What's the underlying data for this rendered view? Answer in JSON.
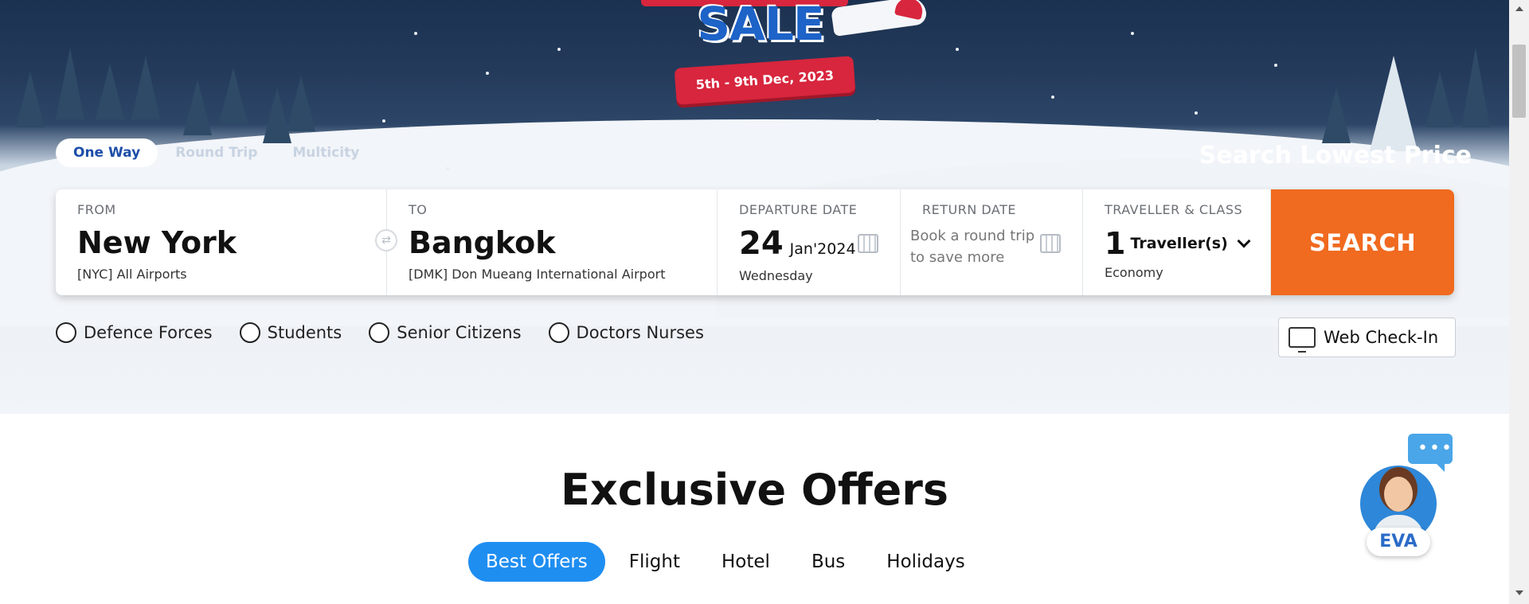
{
  "banner": {
    "headline": "SALE",
    "dates": "5th - 9th Dec, 2023"
  },
  "trip_types": [
    {
      "label": "One Way",
      "active": true
    },
    {
      "label": "Round Trip",
      "active": false
    },
    {
      "label": "Multicity",
      "active": false
    }
  ],
  "tagline": "Search Lowest Price",
  "search": {
    "from": {
      "label": "FROM",
      "city": "New York",
      "airport": "[NYC] All Airports"
    },
    "to": {
      "label": "TO",
      "city": "Bangkok",
      "airport": "[DMK] Don Mueang International Airport"
    },
    "departure": {
      "label": "DEPARTURE DATE",
      "day": "24",
      "month_year": "Jan'2024",
      "weekday": "Wednesday"
    },
    "return": {
      "label": "RETURN DATE",
      "note": "Book a round trip to save more"
    },
    "traveller": {
      "label": "TRAVELLER & CLASS",
      "count": "1",
      "unit": "Traveller(s)",
      "class": "Economy"
    },
    "button": "SEARCH"
  },
  "special_fares": [
    "Defence Forces",
    "Students",
    "Senior Citizens",
    "Doctors Nurses"
  ],
  "web_checkin": "Web Check-In",
  "offers": {
    "title": "Exclusive Offers",
    "tabs": [
      {
        "label": "Best Offers",
        "active": true
      },
      {
        "label": "Flight",
        "active": false
      },
      {
        "label": "Hotel",
        "active": false
      },
      {
        "label": "Bus",
        "active": false
      },
      {
        "label": "Holidays",
        "active": false
      }
    ]
  },
  "chatbot": {
    "name": "EVA",
    "bubble": "•••"
  },
  "colors": {
    "accent_orange": "#f06a1f",
    "accent_blue": "#1f8ef1",
    "brand_blue": "#1d4ea8"
  }
}
